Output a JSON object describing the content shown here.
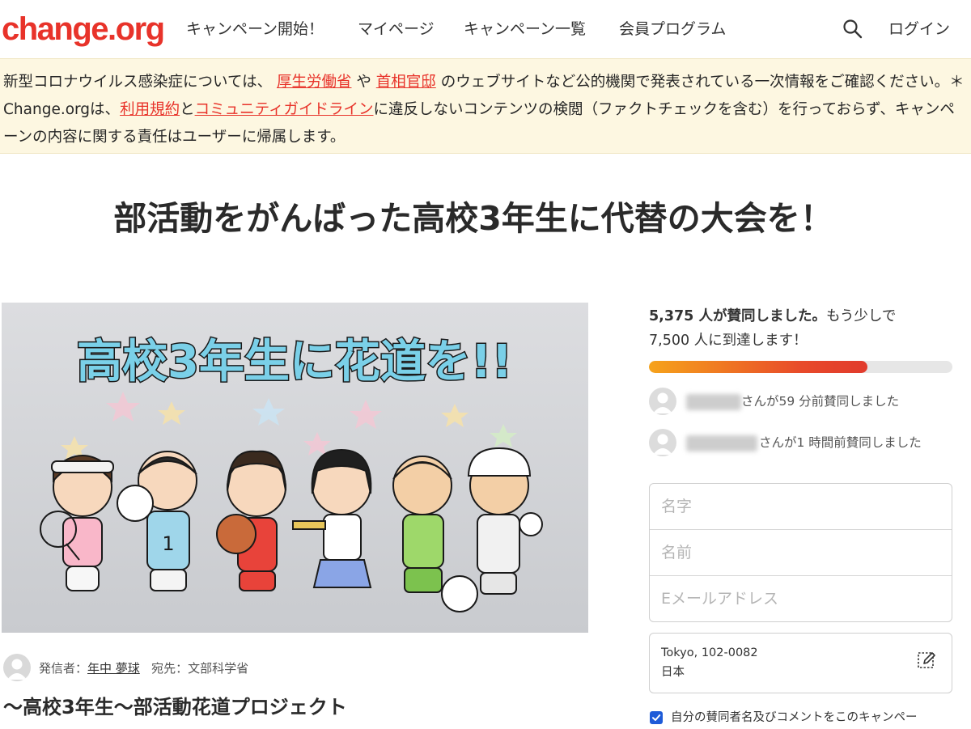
{
  "header": {
    "logo": "change.org",
    "nav": [
      "キャンペーン開始！",
      "マイページ",
      "キャンペーン一覧",
      "会員プログラム"
    ],
    "search_icon": "search-icon",
    "login": "ログイン"
  },
  "notice": {
    "part1": "新型コロナウイルス感染症については、",
    "link1": "厚生労働省",
    "part2": "や",
    "link2": "首相官邸",
    "part3": "のウェブサイトなど公的機関で発表されている一次情報をご確認ください。＊Change.orgは、",
    "link3": "利用規約",
    "part4": "と",
    "link4": "コミュニティガイドライン",
    "part5": "に違反しないコンテンツの検閲（ファクトチェックを含む）を行っておらず、キャンペーンの内容に関する責任はユーザーに帰属します。"
  },
  "title": "部活動をがんばった高校3年生に代替の大会を！",
  "hero": {
    "banner": "高校3年生に花道を!!"
  },
  "author": {
    "label": "発信者：",
    "name": "年中 夢球",
    "to_label": "宛先：",
    "to": "文部科学省"
  },
  "subtitle": "～高校3年生～部活動花道プロジェクト",
  "signatures": {
    "count": "5,375 人が賛同しました。",
    "more": "もう少しで",
    "goal": "7,500 人に到達します！",
    "progress_percent": 72
  },
  "recent": [
    {
      "text": "さんが59 分前賛同しました"
    },
    {
      "text": "さんが1 時間前賛同しました"
    }
  ],
  "form": {
    "last_name_placeholder": "名字",
    "first_name_placeholder": "名前",
    "email_placeholder": "Eメールアドレス"
  },
  "location": {
    "line1": "Tokyo, 102-0082",
    "line2": "日本",
    "edit_icon": "edit-icon"
  },
  "consent": {
    "label": "自分の賛同者名及びコメントをこのキャンペー",
    "checked": true
  },
  "colors": {
    "brand": "#e8332a",
    "notice_bg": "#fdf7e1",
    "progress_start": "#f6a31b",
    "progress_end": "#e13b2d",
    "checkbox": "#1e5bd8"
  }
}
